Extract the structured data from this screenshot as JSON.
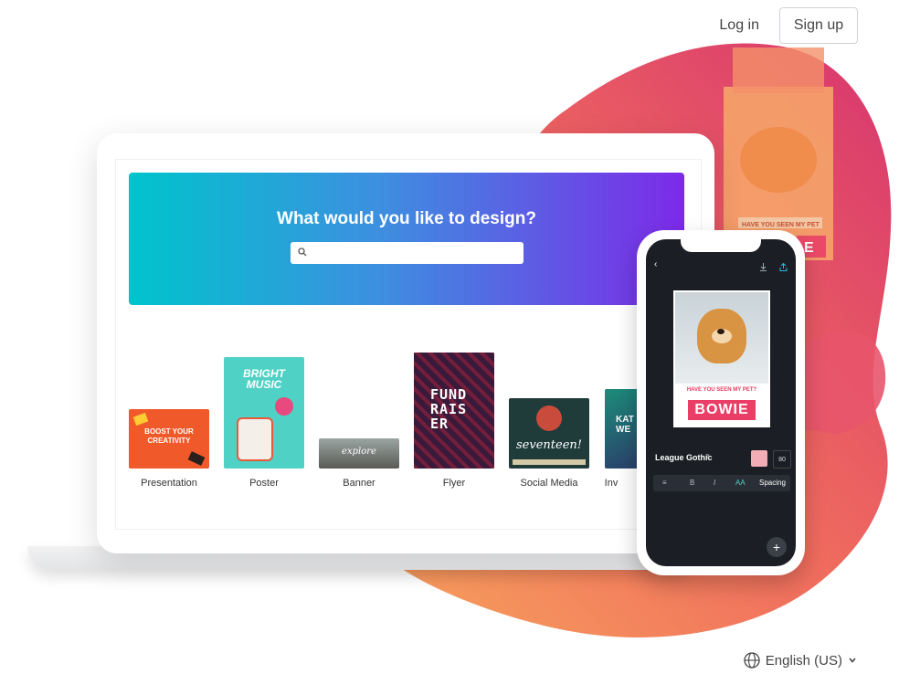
{
  "nav": {
    "login": "Log in",
    "signup": "Sign up"
  },
  "hero": {
    "title": "What would you like to design?",
    "search_placeholder": ""
  },
  "templates": [
    {
      "label": "Presentation",
      "text": "BOOST YOUR CREATIVITY"
    },
    {
      "label": "Poster",
      "text": "BRIGHT MUSIC"
    },
    {
      "label": "Banner",
      "text": "explore"
    },
    {
      "label": "Flyer",
      "text": "FUND RAIS ER"
    },
    {
      "label": "Social Media",
      "text": "seventeen!"
    },
    {
      "label": "Inv",
      "text": "KAT WE"
    }
  ],
  "phone": {
    "pet_caption": "HAVE YOU SEEN MY PET?",
    "pet_name": "BOWIE",
    "font_name": "League Gothic",
    "font_size": "80",
    "toolbar": [
      "B",
      "I",
      "AA",
      "Spacing"
    ]
  },
  "bg_poster": {
    "caption": "HAVE YOU SEEN MY PET",
    "letter": "E"
  },
  "footer": {
    "language": "English (US)"
  },
  "colors": {
    "hero_start": "#00c4cc",
    "hero_end": "#7d2ae8",
    "blob_start": "#f89a5f",
    "blob_end": "#e0466d"
  }
}
